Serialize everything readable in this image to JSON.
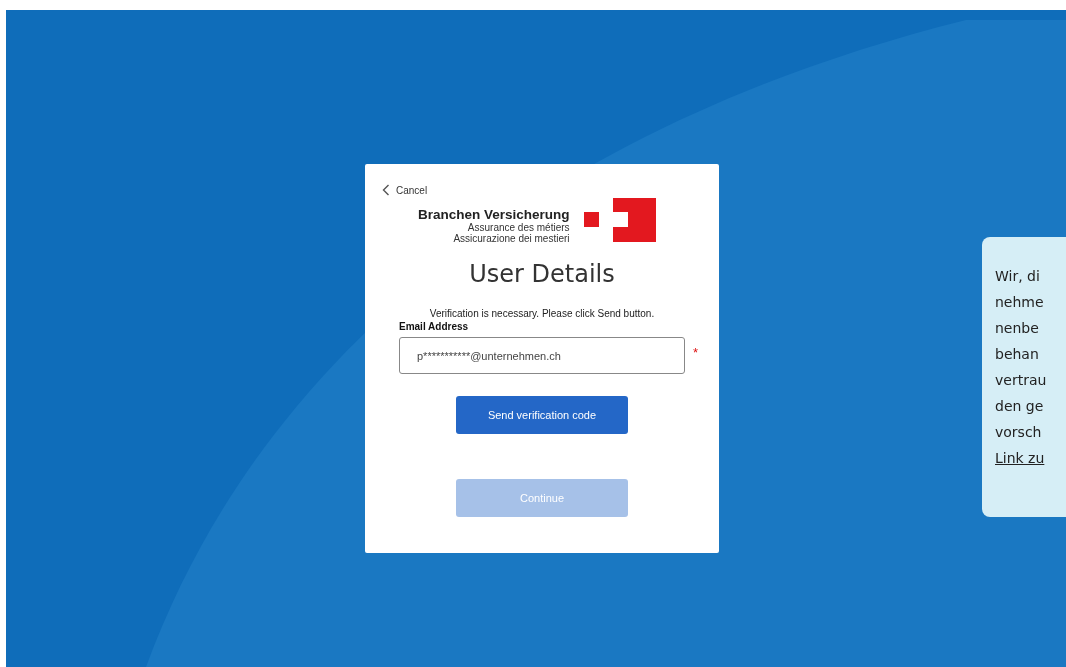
{
  "dialog": {
    "cancel": "Cancel",
    "brand": {
      "name": "Branchen Versicherung",
      "line_fr": "Assurance des métiers",
      "line_it": "Assicurazione dei mestieri"
    },
    "title": "User Details",
    "intro": "Verification is necessary. Please click Send button.",
    "email": {
      "label": "Email Address",
      "value": "p***********@unternehmen.ch",
      "required": true,
      "marker": "*"
    },
    "buttons": [
      {
        "label": "Send verification code",
        "disabled": false
      },
      {
        "label": "Continue",
        "disabled": true
      }
    ]
  },
  "info_panel": {
    "lines": [
      "Wir, di",
      "nehme",
      "nenbe",
      "behan",
      "vertrau",
      "den ge",
      "vorsch"
    ],
    "link": "Link zu"
  }
}
